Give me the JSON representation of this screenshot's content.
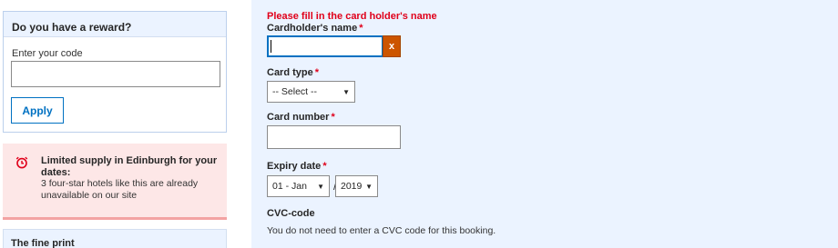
{
  "sidebar": {
    "reward": {
      "title": "Do you have a reward?",
      "input_label": "Enter your code",
      "input_value": "",
      "apply_label": "Apply"
    },
    "alert": {
      "icon": "alarm-clock-icon",
      "title": "Limited supply in Edinburgh for your dates:",
      "text": "3 four-star hotels like this are already unavailable on our site"
    },
    "fine_print": {
      "title": "The fine print"
    }
  },
  "form": {
    "error_message": "Please fill in the card holder's name",
    "required_marker": "*",
    "cardholder": {
      "label": "Cardholder's name",
      "value": "",
      "clear_icon": "x-icon",
      "clear_glyph": "x"
    },
    "card_type": {
      "label": "Card type",
      "selected": "-- Select --"
    },
    "card_number": {
      "label": "Card number",
      "value": ""
    },
    "expiry": {
      "label": "Expiry date",
      "month_selected": "01 - Jan",
      "separator": "/",
      "year_selected": "2019"
    },
    "cvc": {
      "label": "CVC-code",
      "note": "You do not need to enter a CVC code for this booking."
    },
    "dropdown_arrow": "▼"
  },
  "colors": {
    "accent": "#0071c2",
    "error": "#e0001a",
    "panel_bg": "#ebf3ff",
    "alert_bg": "#fde7e7",
    "clear_button": "#cc5500"
  }
}
